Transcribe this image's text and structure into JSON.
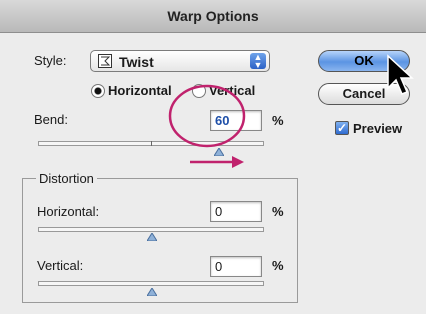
{
  "dialog": {
    "title": "Warp Options"
  },
  "style": {
    "label": "Style:",
    "value": "Twist",
    "icon": "warp-style-icon"
  },
  "orientation": {
    "horizontal_label": "Horizontal",
    "vertical_label": "Vertical",
    "selected": "Horizontal"
  },
  "bend": {
    "label": "Bend:",
    "value": "60",
    "unit": "%",
    "slider_level_percent": 60
  },
  "distortion": {
    "group_label": "Distortion",
    "horizontal": {
      "label": "Horizontal:",
      "value": "0",
      "unit": "%",
      "slider_level_percent": 0
    },
    "vertical": {
      "label": "Vertical:",
      "value": "0",
      "unit": "%",
      "slider_level_percent": 0
    }
  },
  "buttons": {
    "ok": "OK",
    "cancel": "Cancel"
  },
  "preview": {
    "label": "Preview",
    "checked": true
  },
  "annotation": {
    "color": "#c0226d"
  },
  "colors": {
    "accent": "#5b94e3",
    "slider_thumb": "#8fb1d8"
  }
}
